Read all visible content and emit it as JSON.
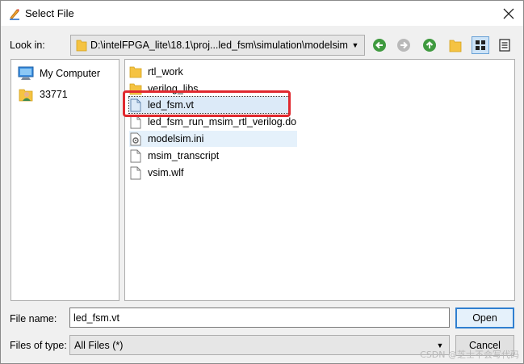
{
  "window": {
    "title": "Select File"
  },
  "toolbar": {
    "look_in_label": "Look in:",
    "look_in_path": "D:\\intelFPGA_lite\\18.1\\proj...led_fsm\\simulation\\modelsim"
  },
  "sidebar": {
    "items": [
      {
        "label": "My Computer",
        "icon": "computer-icon"
      },
      {
        "label": "33771",
        "icon": "user-folder-icon"
      }
    ]
  },
  "files": [
    {
      "name": "rtl_work",
      "icon": "folder-icon"
    },
    {
      "name": "verilog_libs",
      "icon": "folder-icon"
    },
    {
      "name": "led_fsm.vt",
      "icon": "file-icon",
      "selected": true
    },
    {
      "name": "led_fsm_run_msim_rtl_verilog.do",
      "icon": "file-icon"
    },
    {
      "name": "modelsim.ini",
      "icon": "settings-file-icon"
    },
    {
      "name": "msim_transcript",
      "icon": "file-icon"
    },
    {
      "name": "vsim.wlf",
      "icon": "file-icon"
    }
  ],
  "form": {
    "file_name_label": "File name:",
    "file_name_value": "led_fsm.vt",
    "file_type_label": "Files of type:",
    "file_type_value": "All Files (*)"
  },
  "buttons": {
    "open": "Open",
    "cancel": "Cancel"
  },
  "watermark": "CSDN @芝士不会写代码",
  "colors": {
    "highlight": "#e0282e",
    "accent": "#2f7fd0",
    "folder": "#f5c342"
  }
}
